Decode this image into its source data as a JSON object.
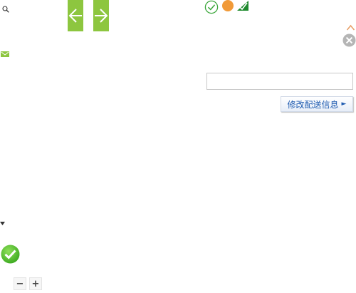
{
  "icons": {
    "magnifier": "magnifier-icon",
    "prev": "arrow-left-icon",
    "next": "arrow-right-icon",
    "check": "check-circle-icon",
    "dot": "orange-dot-icon",
    "flag": "green-check-flag-icon",
    "collapse": "chevron-up-icon",
    "close": "close-circle-icon",
    "mail": "mail-icon",
    "dropdown": "caret-down-icon",
    "success": "big-check-icon"
  },
  "colors": {
    "accent_green": "#8dc63f",
    "check_green": "#3aa63a",
    "orange": "#f19a38",
    "close_gray": "#b5b5b5",
    "chevron_orange": "#e8a06a",
    "link_blue": "#1e5bb0"
  },
  "address_input": {
    "value": "",
    "placeholder": ""
  },
  "modify_delivery": {
    "label": "修改配送信息",
    "arrow": "►"
  },
  "stepper": {
    "minus": "−",
    "plus": "+"
  }
}
